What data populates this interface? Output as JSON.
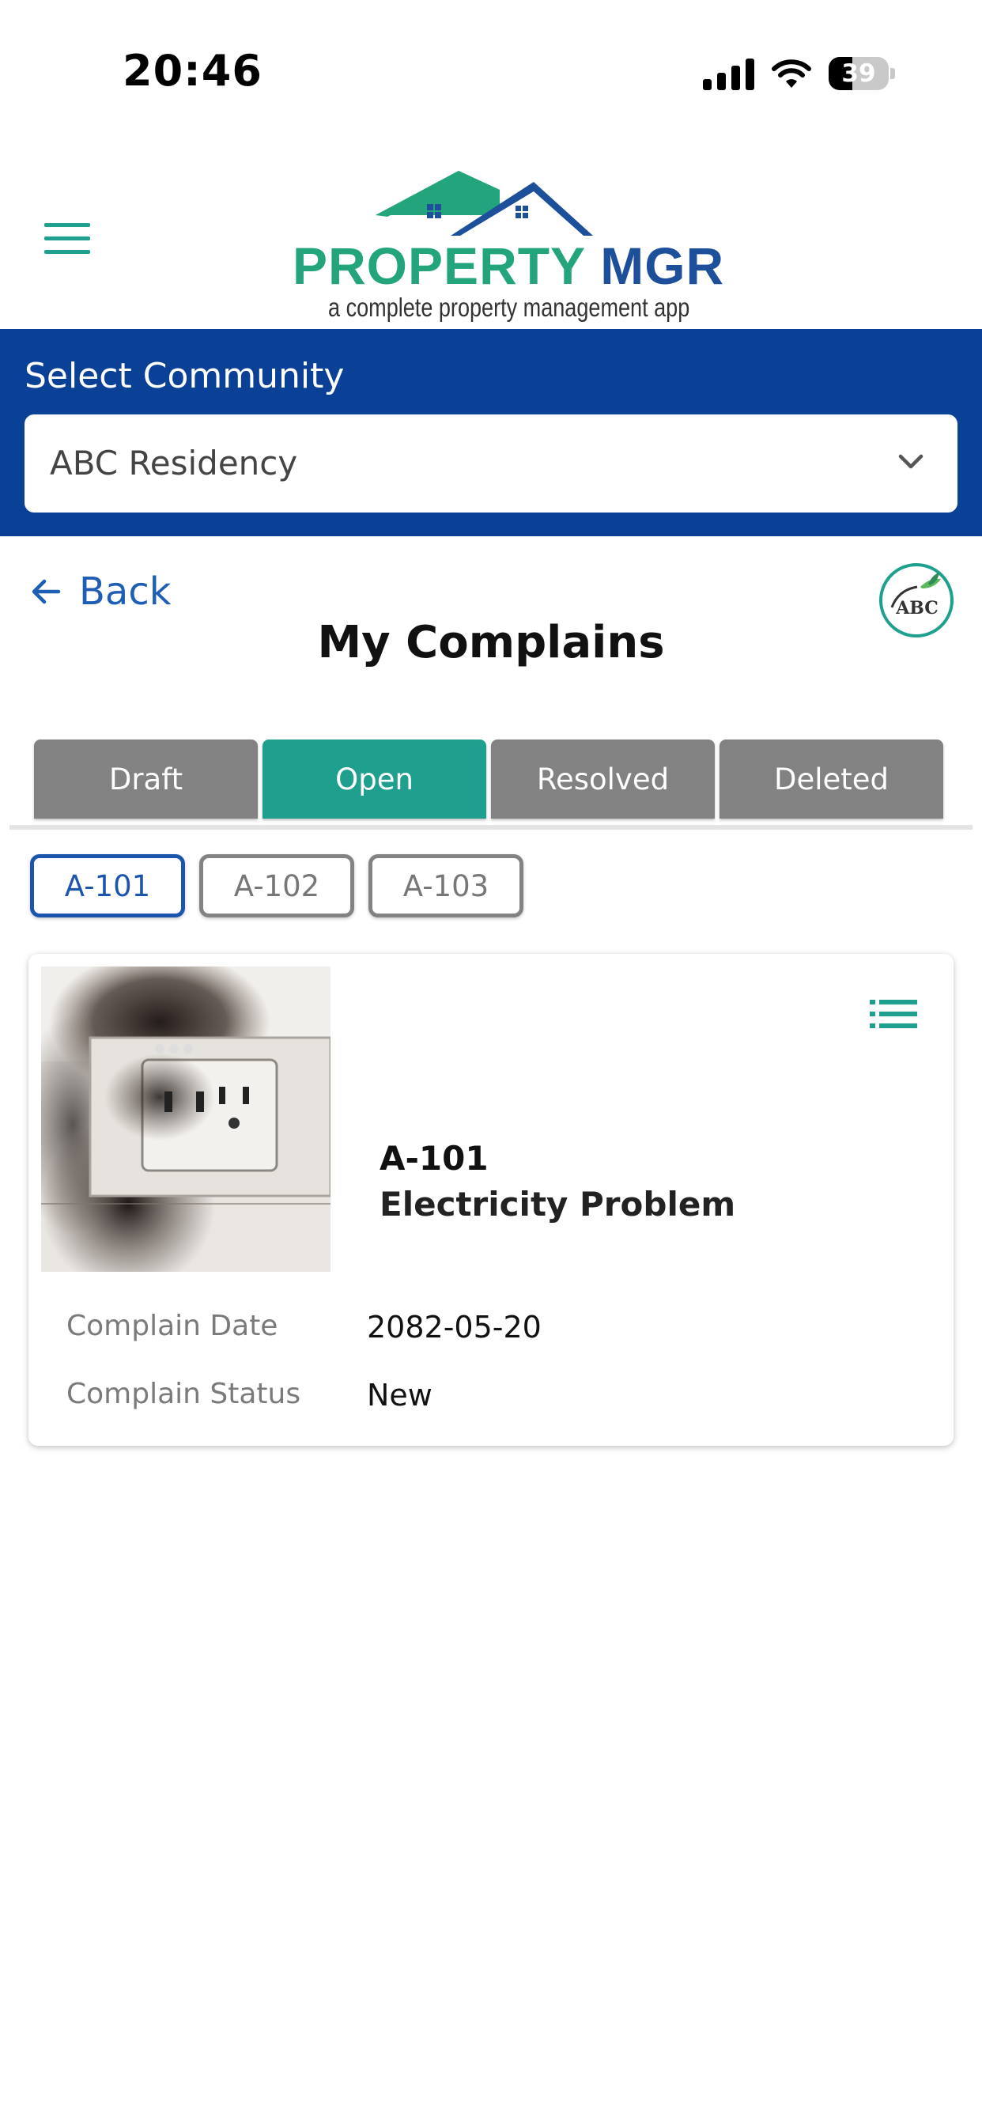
{
  "status_bar": {
    "time": "20:46",
    "battery_level": "39",
    "battery_fraction": 0.39
  },
  "header": {
    "logo_title_part1": "PROPERTY",
    "logo_title_part2": "MGR",
    "logo_tagline": "a complete property management app"
  },
  "community": {
    "label": "Select Community",
    "selected": "ABC Residency"
  },
  "nav": {
    "back_label": "Back"
  },
  "page": {
    "title": "My Complains",
    "org_logo_text": "ABC"
  },
  "tabs": [
    {
      "label": "Draft",
      "active": false
    },
    {
      "label": "Open",
      "active": true
    },
    {
      "label": "Resolved",
      "active": false
    },
    {
      "label": "Deleted",
      "active": false
    }
  ],
  "units": [
    {
      "label": "A-101",
      "active": true
    },
    {
      "label": "A-102",
      "active": false
    },
    {
      "label": "A-103",
      "active": false
    }
  ],
  "complaint": {
    "unit": "A-101",
    "title": "Electricity Problem",
    "date_label": "Complain Date",
    "date_value": "2082-05-20",
    "status_label": "Complain Status",
    "status_value": "New"
  },
  "colors": {
    "brand_teal": "#1fa08e",
    "brand_blue": "#0a4196",
    "link_blue": "#1e5eb5",
    "tab_inactive": "#828282"
  }
}
